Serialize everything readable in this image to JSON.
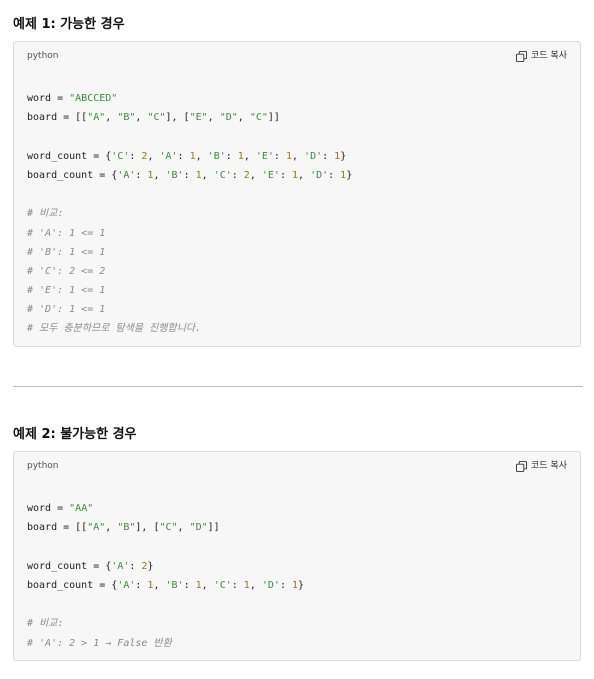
{
  "sections": [
    {
      "title": "예제 1: 가능한 경우",
      "language": "python",
      "copy_label": "코드 복사",
      "lines": [
        [],
        [
          [
            "p",
            "word = "
          ],
          [
            "s",
            "\"ABCCED\""
          ]
        ],
        [
          [
            "p",
            "board = [["
          ],
          [
            "s",
            "\"A\""
          ],
          [
            "p",
            ", "
          ],
          [
            "s",
            "\"B\""
          ],
          [
            "p",
            ", "
          ],
          [
            "s",
            "\"C\""
          ],
          [
            "p",
            "], ["
          ],
          [
            "s",
            "\"E\""
          ],
          [
            "p",
            ", "
          ],
          [
            "s",
            "\"D\""
          ],
          [
            "p",
            ", "
          ],
          [
            "s",
            "\"C\""
          ],
          [
            "p",
            "]]"
          ]
        ],
        [],
        [
          [
            "p",
            "word_count = {"
          ],
          [
            "s",
            "'C'"
          ],
          [
            "p",
            ": "
          ],
          [
            "n",
            "2"
          ],
          [
            "p",
            ", "
          ],
          [
            "s",
            "'A'"
          ],
          [
            "p",
            ": "
          ],
          [
            "n",
            "1"
          ],
          [
            "p",
            ", "
          ],
          [
            "s",
            "'B'"
          ],
          [
            "p",
            ": "
          ],
          [
            "n",
            "1"
          ],
          [
            "p",
            ", "
          ],
          [
            "s",
            "'E'"
          ],
          [
            "p",
            ": "
          ],
          [
            "n",
            "1"
          ],
          [
            "p",
            ", "
          ],
          [
            "s",
            "'D'"
          ],
          [
            "p",
            ": "
          ],
          [
            "n",
            "1"
          ],
          [
            "p",
            "}"
          ]
        ],
        [
          [
            "p",
            "board_count = {"
          ],
          [
            "s",
            "'A'"
          ],
          [
            "p",
            ": "
          ],
          [
            "n",
            "1"
          ],
          [
            "p",
            ", "
          ],
          [
            "s",
            "'B'"
          ],
          [
            "p",
            ": "
          ],
          [
            "n",
            "1"
          ],
          [
            "p",
            ", "
          ],
          [
            "s",
            "'C'"
          ],
          [
            "p",
            ": "
          ],
          [
            "n",
            "2"
          ],
          [
            "p",
            ", "
          ],
          [
            "s",
            "'E'"
          ],
          [
            "p",
            ": "
          ],
          [
            "n",
            "1"
          ],
          [
            "p",
            ", "
          ],
          [
            "s",
            "'D'"
          ],
          [
            "p",
            ": "
          ],
          [
            "n",
            "1"
          ],
          [
            "p",
            "}"
          ]
        ],
        [],
        [
          [
            "c",
            "# 비교:"
          ]
        ],
        [
          [
            "c",
            "# 'A': 1 <= 1"
          ]
        ],
        [
          [
            "c",
            "# 'B': 1 <= 1"
          ]
        ],
        [
          [
            "c",
            "# 'C': 2 <= 2"
          ]
        ],
        [
          [
            "c",
            "# 'E': 1 <= 1"
          ]
        ],
        [
          [
            "c",
            "# 'D': 1 <= 1"
          ]
        ],
        [
          [
            "c",
            "# 모두 충분하므로 탐색을 진행합니다."
          ]
        ]
      ]
    },
    {
      "title": "예제 2: 불가능한 경우",
      "language": "python",
      "copy_label": "코드 복사",
      "lines": [
        [],
        [
          [
            "p",
            "word = "
          ],
          [
            "s",
            "\"AA\""
          ]
        ],
        [
          [
            "p",
            "board = [["
          ],
          [
            "s",
            "\"A\""
          ],
          [
            "p",
            ", "
          ],
          [
            "s",
            "\"B\""
          ],
          [
            "p",
            "], ["
          ],
          [
            "s",
            "\"C\""
          ],
          [
            "p",
            ", "
          ],
          [
            "s",
            "\"D\""
          ],
          [
            "p",
            "]]"
          ]
        ],
        [],
        [
          [
            "p",
            "word_count = {"
          ],
          [
            "s",
            "'A'"
          ],
          [
            "p",
            ": "
          ],
          [
            "n",
            "2"
          ],
          [
            "p",
            "}"
          ]
        ],
        [
          [
            "p",
            "board_count = {"
          ],
          [
            "s",
            "'A'"
          ],
          [
            "p",
            ": "
          ],
          [
            "n",
            "1"
          ],
          [
            "p",
            ", "
          ],
          [
            "s",
            "'B'"
          ],
          [
            "p",
            ": "
          ],
          [
            "n",
            "1"
          ],
          [
            "p",
            ", "
          ],
          [
            "s",
            "'C'"
          ],
          [
            "p",
            ": "
          ],
          [
            "n",
            "1"
          ],
          [
            "p",
            ", "
          ],
          [
            "s",
            "'D'"
          ],
          [
            "p",
            ": "
          ],
          [
            "n",
            "1"
          ],
          [
            "p",
            "}"
          ]
        ],
        [],
        [
          [
            "c",
            "# 비교:"
          ]
        ],
        [
          [
            "c",
            "# 'A': 2 > 1 → False 반환"
          ]
        ]
      ]
    }
  ]
}
